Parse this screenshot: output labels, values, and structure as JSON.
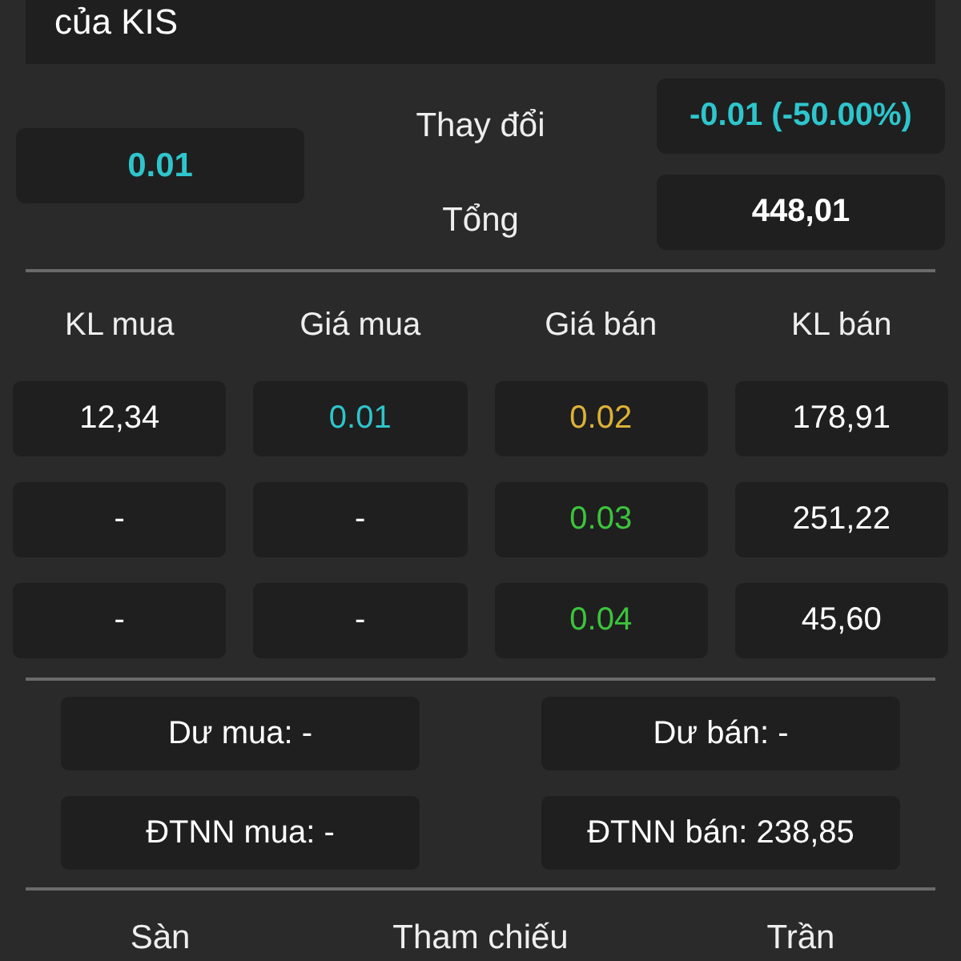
{
  "header": {
    "text": "của KIS"
  },
  "summary": {
    "price": {
      "value": "0.01",
      "color": "#2ec5cc"
    },
    "change": {
      "label": "Thay đổi",
      "value": "-0.01 (-50.00%)",
      "color": "#2ec5cc"
    },
    "total": {
      "label": "Tổng",
      "value": "448,01",
      "color": "#ffffff"
    }
  },
  "order_book": {
    "columns": [
      "KL mua",
      "Giá mua",
      "Giá bán",
      "KL bán"
    ],
    "rows": [
      [
        {
          "text": "12,34",
          "color": "#ffffff"
        },
        {
          "text": "0.01",
          "color": "#2ec5cc"
        },
        {
          "text": "0.02",
          "color": "#dcb236"
        },
        {
          "text": "178,91",
          "color": "#ffffff"
        }
      ],
      [
        {
          "text": "-",
          "color": "#ffffff"
        },
        {
          "text": "-",
          "color": "#ffffff"
        },
        {
          "text": "0.03",
          "color": "#3cc43c"
        },
        {
          "text": "251,22",
          "color": "#ffffff"
        }
      ],
      [
        {
          "text": "-",
          "color": "#ffffff"
        },
        {
          "text": "-",
          "color": "#ffffff"
        },
        {
          "text": "0.04",
          "color": "#3cc43c"
        },
        {
          "text": "45,60",
          "color": "#ffffff"
        }
      ]
    ]
  },
  "balances": [
    "Dư mua: -",
    "Dư bán: -",
    "ĐTNN mua: -",
    "ĐTNN bán: 238,85"
  ],
  "limits": [
    "Sàn",
    "Tham chiếu",
    "Trần"
  ]
}
